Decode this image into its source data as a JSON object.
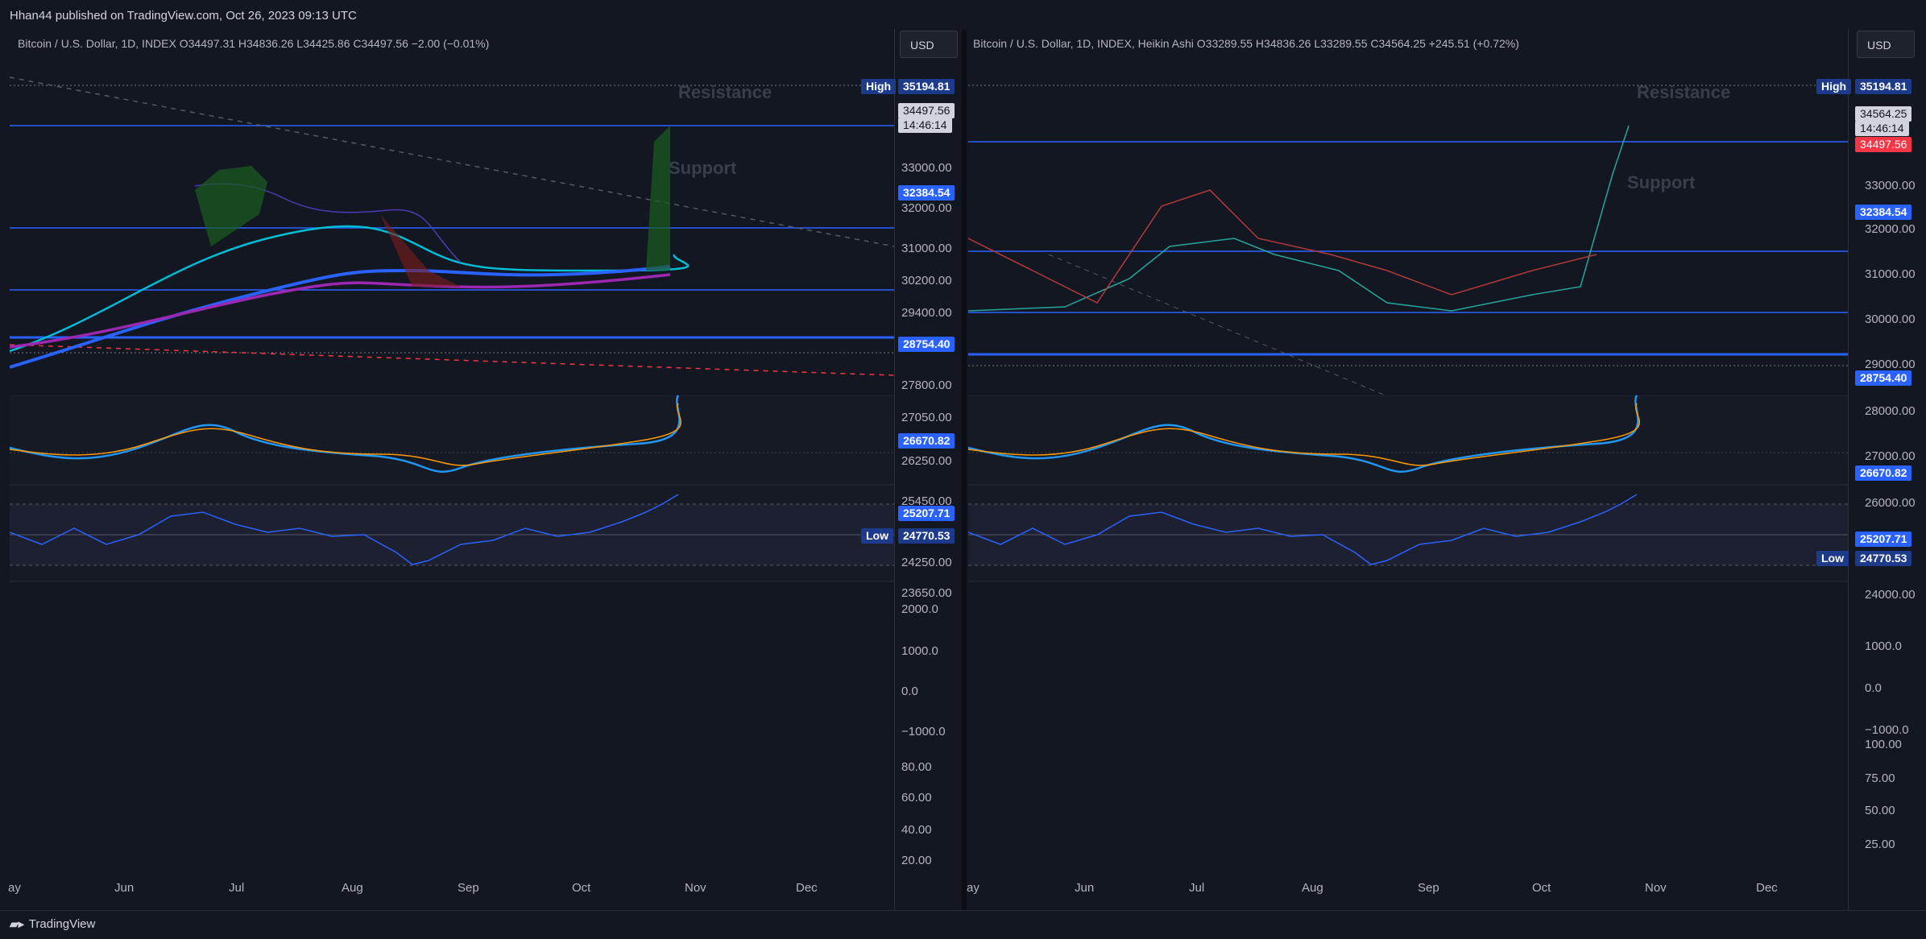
{
  "header": {
    "publisher": "Hhan44 published on TradingView.com, Oct 26, 2023 09:13 UTC"
  },
  "footer": {
    "brand": "TradingView"
  },
  "left": {
    "legend": "Bitcoin / U.S. Dollar, 1D, INDEX  O34497.31  H34836.26  L34425.86  C34497.56  −2.00 (−0.01%)",
    "currency": "USD",
    "price_ticks": [
      "33000.00",
      "32000.00",
      "31000.00",
      "30200.00",
      "29400.00",
      "27800.00",
      "27050.00",
      "26250.00",
      "25450.00",
      "24250.00",
      "23650.00"
    ],
    "high_label": "High",
    "high_value": "35194.81",
    "low_label": "Low",
    "low_value": "24770.53",
    "last_price": "34497.56",
    "countdown": "14:46:14",
    "levels": [
      "32384.54",
      "28754.40",
      "26670.82",
      "25207.71"
    ],
    "resistance": "Resistance",
    "support": "Support",
    "macd_ticks": [
      "2000.0",
      "1000.0",
      "0.0",
      "−1000.0"
    ],
    "rsi_ticks": [
      "80.00",
      "60.00",
      "40.00",
      "20.00"
    ],
    "months": [
      "ay",
      "Jun",
      "Jul",
      "Aug",
      "Sep",
      "Oct",
      "Nov",
      "Dec"
    ]
  },
  "right": {
    "legend": "Bitcoin / U.S. Dollar, 1D, INDEX, Heikin Ashi  O33289.55  H34836.26  L33289.55  C34564.25  +245.51 (+0.72%)",
    "currency": "USD",
    "price_ticks": [
      "33000.00",
      "32000.00",
      "31000.00",
      "30000.00",
      "29000.00",
      "28000.00",
      "27000.00",
      "26000.00",
      "24000.00"
    ],
    "high_label": "High",
    "high_value": "35194.81",
    "low_label": "Low",
    "low_value": "24770.53",
    "last_price": "34564.25",
    "countdown": "14:46:14",
    "prev_close": "34497.56",
    "levels": [
      "32384.54",
      "28754.40",
      "26670.82",
      "25207.71"
    ],
    "resistance": "Resistance",
    "support": "Support",
    "macd_ticks": [
      "1000.0",
      "0.0",
      "−1000.0"
    ],
    "rsi_ticks": [
      "100.00",
      "75.00",
      "50.00",
      "25.00"
    ],
    "months": [
      "ay",
      "Jun",
      "Jul",
      "Aug",
      "Sep",
      "Oct",
      "Nov",
      "Dec"
    ]
  },
  "colors": {
    "bg": "#131722",
    "up": "#ffffff",
    "down": "#f23645",
    "level": "#2962ff",
    "macd": "#2196f3",
    "signal": "#ff9800",
    "rsi": "#2962ff"
  }
}
